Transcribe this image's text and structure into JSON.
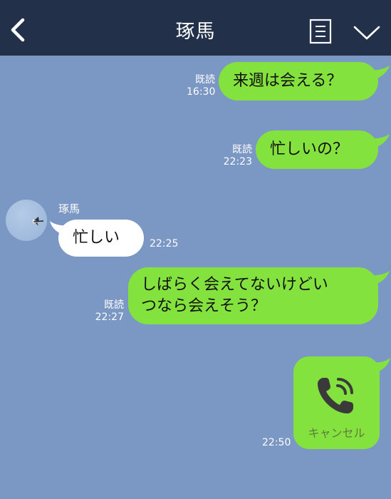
{
  "header": {
    "title": "琢馬",
    "back_icon": "chevron-left-icon",
    "menu_icon": "note-list-icon",
    "dropdown_icon": "chevron-down-icon"
  },
  "messages": [
    {
      "direction": "out",
      "text": "来週は会える？",
      "read": "既読",
      "time": "16:30"
    },
    {
      "direction": "out",
      "text": "忙しいの？",
      "read": "既読",
      "time": "22:23"
    },
    {
      "direction": "in",
      "sender": "琢馬",
      "text": "忙しい",
      "time": "22:25"
    },
    {
      "direction": "out",
      "text_line1": "しばらく会えてないけどい",
      "text_line2": "つなら会えそう？",
      "read": "既読",
      "time": "22:27"
    },
    {
      "direction": "out",
      "type": "call",
      "call_status": "キャンセル",
      "time": "22:50",
      "icon": "phone-icon"
    }
  ],
  "colors": {
    "background": "#7b97c4",
    "header": "#22304a",
    "outgoing_bubble": "#84e23f",
    "incoming_bubble": "#ffffff"
  }
}
